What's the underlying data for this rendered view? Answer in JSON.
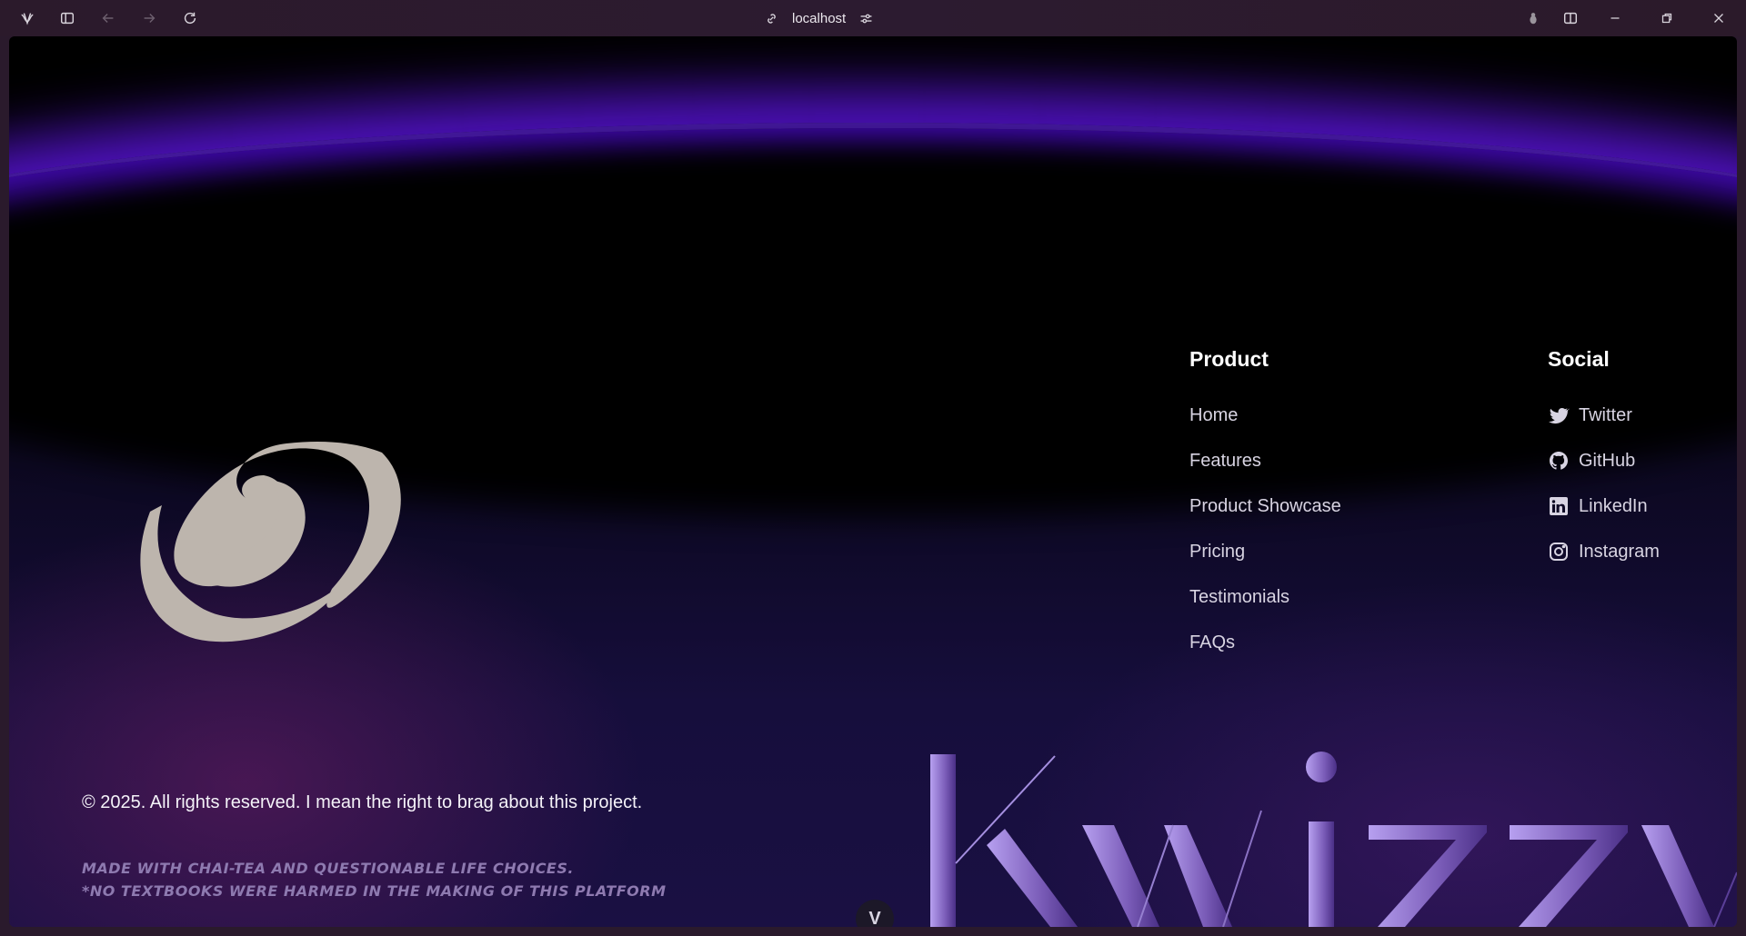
{
  "browser": {
    "url": "localhost",
    "icons": [
      "app-logo-icon",
      "sidebar-toggle-icon",
      "back-icon",
      "forward-icon",
      "reload-icon",
      "link-icon",
      "site-settings-icon",
      "extension-icon",
      "split-view-icon",
      "minimize-icon",
      "maximize-icon",
      "close-icon"
    ]
  },
  "footer": {
    "product": {
      "title": "Product",
      "links": [
        "Home",
        "Features",
        "Product Showcase",
        "Pricing",
        "Testimonials",
        "FAQs"
      ]
    },
    "social": {
      "title": "Social",
      "links": [
        {
          "label": "Twitter",
          "icon": "twitter-icon"
        },
        {
          "label": "GitHub",
          "icon": "github-icon"
        },
        {
          "label": "LinkedIn",
          "icon": "linkedin-icon"
        },
        {
          "label": "Instagram",
          "icon": "instagram-icon"
        }
      ]
    },
    "copyright": "© 2025. All rights reserved. I mean the right to brag about this project.",
    "tagline_1": "Made with chai-tea and questionable life choices.",
    "tagline_2": "*No textbooks were harmed in the making of this platform",
    "wordmark": "Kwizzy",
    "scroll_glyph": "V"
  },
  "colors": {
    "accent_glow": "#5a14dc",
    "wordmark": "#a58fe0",
    "background": "#000000"
  }
}
